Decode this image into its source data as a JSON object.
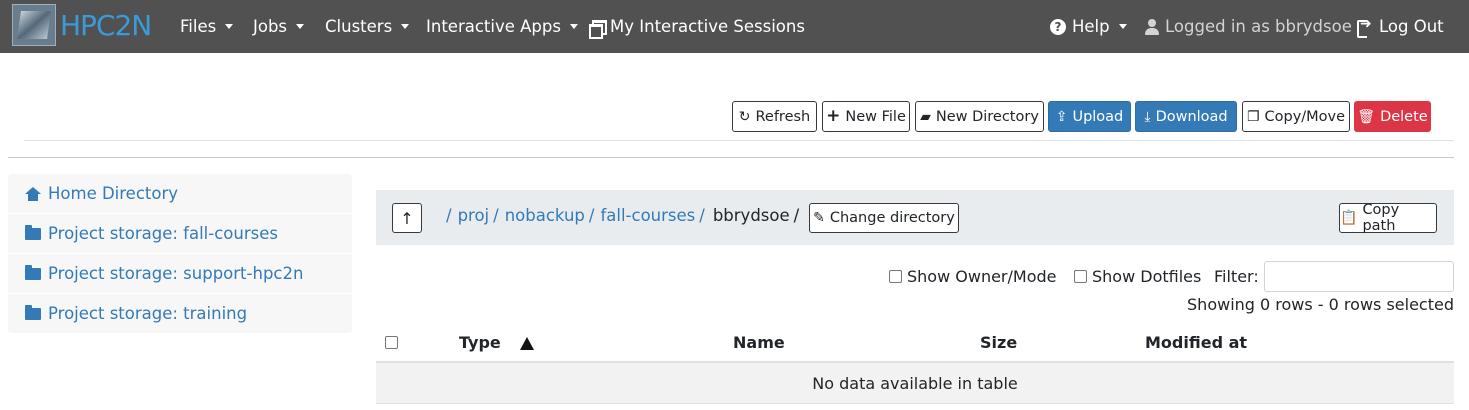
{
  "brand": {
    "name": "HPC2N"
  },
  "nav": {
    "files": "Files",
    "jobs": "Jobs",
    "clusters": "Clusters",
    "interactive_apps": "Interactive Apps",
    "my_sessions": "My Interactive Sessions",
    "help": "Help",
    "logged_in": "Logged in as bbrydsoe",
    "log_out": "Log Out"
  },
  "toolbar": {
    "refresh": "Refresh",
    "new_file": "New File",
    "new_directory": "New Directory",
    "upload": "Upload",
    "download": "Download",
    "copy_move": "Copy/Move",
    "delete": "Delete"
  },
  "sidebar": {
    "items": [
      {
        "label": "Home Directory",
        "icon": "home-icon"
      },
      {
        "label": "Project storage: fall-courses",
        "icon": "folder-icon"
      },
      {
        "label": "Project storage: support-hpc2n",
        "icon": "folder-icon"
      },
      {
        "label": "Project storage: training",
        "icon": "folder-icon"
      }
    ]
  },
  "breadcrumb": {
    "root": "/",
    "parts": [
      "proj",
      "nobackup",
      "fall-courses"
    ],
    "current": "bbrydsoe",
    "change_directory": "Change directory",
    "copy_path": "Copy path"
  },
  "options": {
    "show_owner_mode": "Show Owner/Mode",
    "show_dotfiles": "Show Dotfiles",
    "filter_label": "Filter:",
    "filter_value": "",
    "showing": "Showing 0 rows - 0 rows selected"
  },
  "table": {
    "columns": [
      "Type",
      "Name",
      "Size",
      "Modified at"
    ],
    "sort_indicator": "▲",
    "empty_message": "No data available in table"
  },
  "colors": {
    "navbar": "#515151",
    "link": "#337ab7",
    "primary": "#337ab7",
    "danger": "#dc3545"
  }
}
